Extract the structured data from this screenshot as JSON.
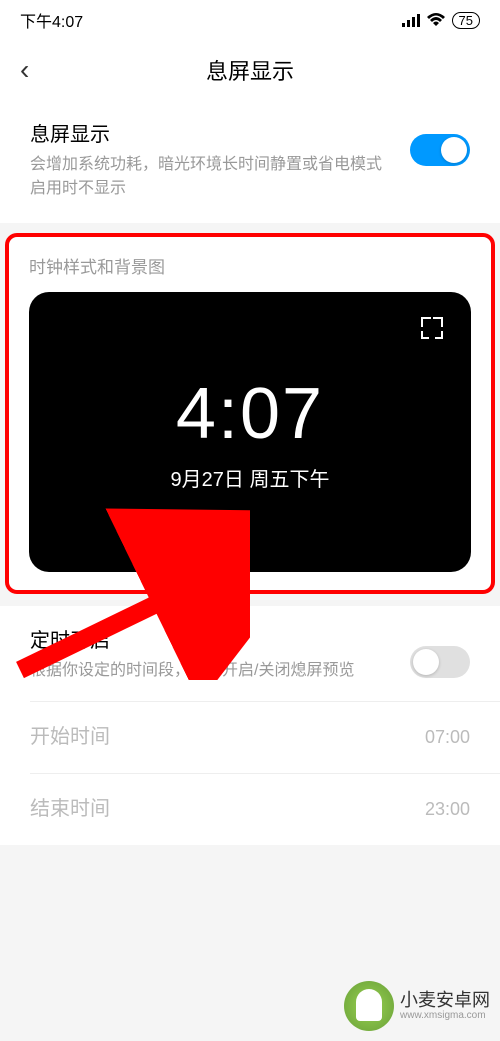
{
  "status_bar": {
    "time": "下午4:07",
    "battery": "75"
  },
  "header": {
    "title": "息屏显示"
  },
  "main_toggle": {
    "title": "息屏显示",
    "desc": "会增加系统功耗，暗光环境长时间静置或省电模式启用时不显示",
    "enabled": true
  },
  "style_section": {
    "label": "时钟样式和背景图",
    "preview_time": "4:07",
    "preview_date": "9月27日 周五下午"
  },
  "schedule": {
    "title": "定时开启",
    "desc": "根据你设定的时间段，自动开启/关闭熄屏预览",
    "enabled": false,
    "start_label": "开始时间",
    "start_value": "07:00",
    "end_label": "结束时间",
    "end_value": "23:00"
  },
  "watermark": {
    "name": "小麦安卓网",
    "url": "www.xmsigma.com"
  }
}
